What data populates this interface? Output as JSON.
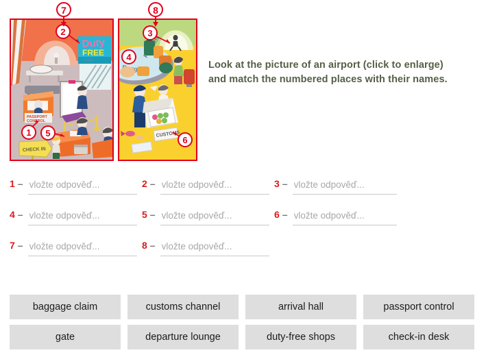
{
  "instruction": {
    "line1": "Look at the picture of an airport (click to enlarge)",
    "line2": "and match the numbered places with their names.",
    "color": "#555f44"
  },
  "pictures": {
    "callouts": [
      {
        "number": "7",
        "target": "departures-panel"
      },
      {
        "number": "8",
        "target": "arrivals-panel"
      }
    ],
    "panels": [
      {
        "name": "departures-panel",
        "alt": "Airport departures hall illustration",
        "border_color": "#e2001a",
        "signs": [
          "Duty",
          "FREE",
          "PASSPORT CONTROL",
          "CHECK IN"
        ],
        "markers": [
          "2",
          "1",
          "5"
        ]
      },
      {
        "name": "arrivals-panel",
        "alt": "Airport arrivals hall illustration",
        "border_color": "#e2001a",
        "signs": [
          "Baggage Reclaim",
          "CUSTOMS"
        ],
        "markers": [
          "3",
          "4",
          "6"
        ]
      }
    ]
  },
  "answers": {
    "placeholder": "vložte odpověď...",
    "dash": "–",
    "number_color": "#d81b1b",
    "rows": [
      [
        {
          "number": "1",
          "value": ""
        },
        {
          "number": "2",
          "value": ""
        },
        {
          "number": "3",
          "value": ""
        }
      ],
      [
        {
          "number": "4",
          "value": ""
        },
        {
          "number": "5",
          "value": ""
        },
        {
          "number": "6",
          "value": ""
        }
      ],
      [
        {
          "number": "7",
          "value": ""
        },
        {
          "number": "8",
          "value": ""
        }
      ]
    ]
  },
  "word_bank": {
    "chip_color": "#dedede",
    "rows": [
      [
        "baggage claim",
        "customs channel",
        "arrival hall",
        "passport control"
      ],
      [
        "gate",
        "departure lounge",
        "duty-free shops",
        "check-in desk"
      ]
    ]
  }
}
